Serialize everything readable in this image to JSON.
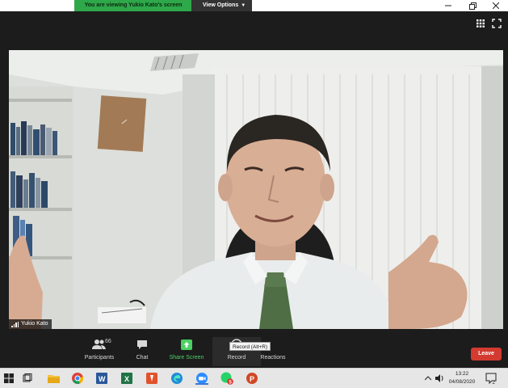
{
  "banner": {
    "viewing_text": "You are viewing Yukio Kato's screen",
    "view_options_label": "View Options",
    "chevron_icon": "chevron-down-icon"
  },
  "window_controls": [
    "minimize-icon",
    "restore-icon",
    "close-icon"
  ],
  "top_icons": [
    "grid-view-icon",
    "fullscreen-icon"
  ],
  "video": {
    "participant_name": "Yukio Kato"
  },
  "toolbar": {
    "participants_label": "Participants",
    "participants_count": "66",
    "chat_label": "Chat",
    "share_screen_label": "Share Screen",
    "record_label": "Record",
    "record_tooltip": "Record (Alt+R)",
    "reactions_label": "Reactions",
    "leave_label": "Leave"
  },
  "taskbar": {
    "apps": [
      "task-view-icon",
      "file-explorer-icon",
      "chrome-icon",
      "word-icon",
      "excel-icon",
      "app-orange-icon",
      "edge-icon",
      "zoom-icon",
      "whatsapp-icon",
      "powerpoint-icon"
    ],
    "whatsapp_badge": "5",
    "time": "13:22",
    "date": "04/08/2020",
    "notifications_count": "2"
  },
  "colors": {
    "banner_green": "#2ea84a",
    "share_green": "#4cd064",
    "leave_red": "#d33a30",
    "toolbar_bg": "#1c1c1c"
  }
}
